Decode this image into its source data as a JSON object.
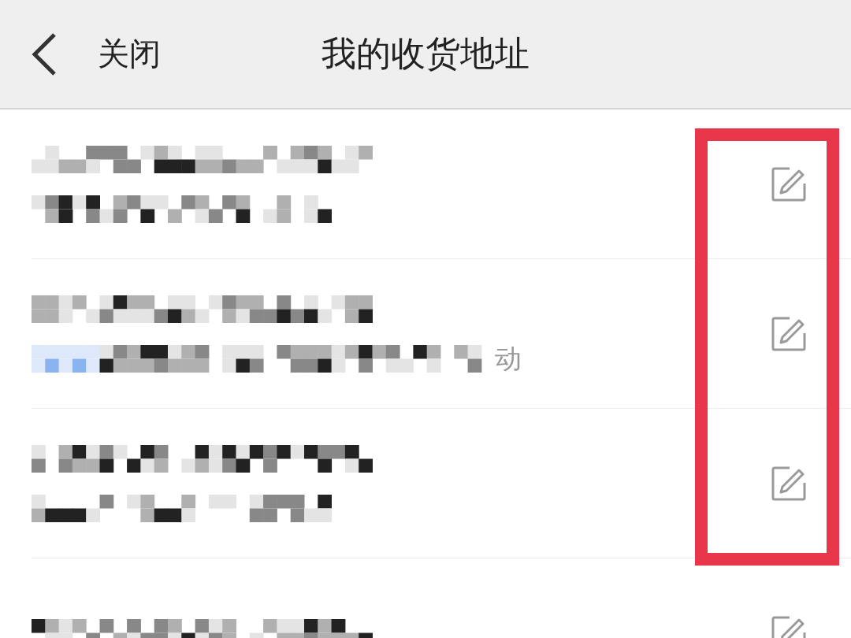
{
  "header": {
    "back_label": "关闭",
    "title": "我的收货地址"
  },
  "addresses": [
    {
      "lines": [
        {
          "kind": "pixelated"
        },
        {
          "kind": "pixelated"
        }
      ],
      "tag": false
    },
    {
      "lines": [
        {
          "kind": "pixelated"
        },
        {
          "kind": "pixelated",
          "tail": "动"
        }
      ],
      "tag": true
    },
    {
      "lines": [
        {
          "kind": "pixelated"
        },
        {
          "kind": "pixelated"
        }
      ],
      "tag": false
    },
    {
      "lines": [
        {
          "kind": "pixelated"
        }
      ],
      "tag": false
    }
  ],
  "annotation": {
    "kind": "highlight-frame"
  }
}
